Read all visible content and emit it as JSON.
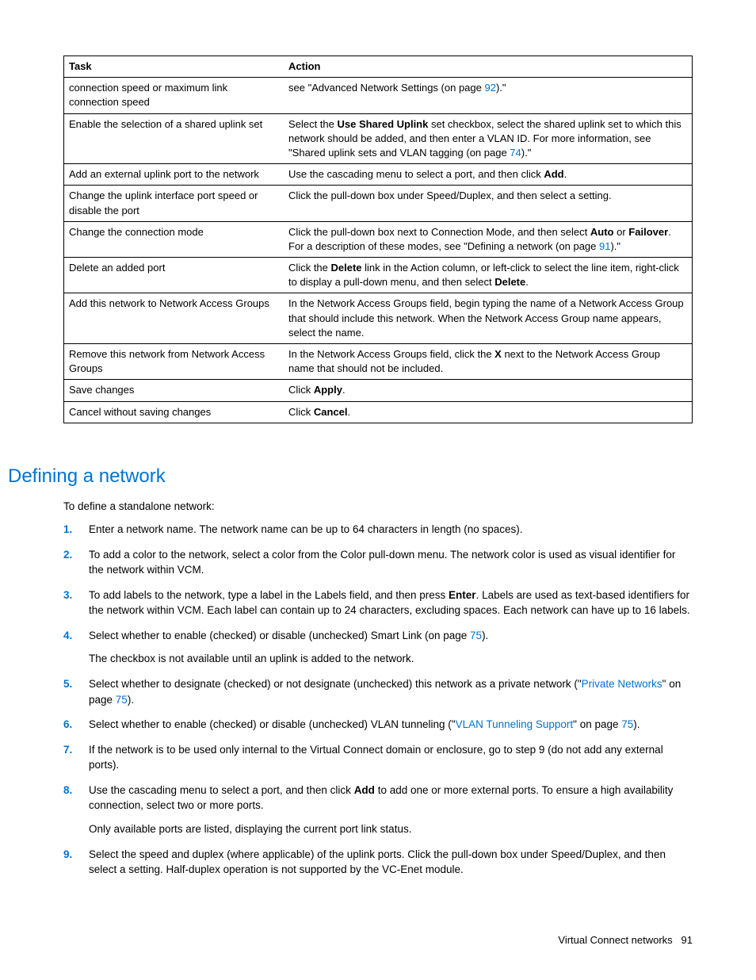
{
  "table": {
    "headers": [
      "Task",
      "Action"
    ],
    "rows": [
      {
        "task": "connection speed or maximum link connection speed",
        "action_pre": "see \"Advanced Network Settings (on page ",
        "action_link": "92",
        "action_post": ").\""
      },
      {
        "task": "Enable the selection of a shared uplink set",
        "action_segments": [
          {
            "t": "Select the "
          },
          {
            "t": "Use Shared Uplink",
            "b": true
          },
          {
            "t": " set checkbox, select the shared uplink set to which this network should be added, and then enter a VLAN ID. For more information, see \"Shared uplink sets and VLAN tagging (on page "
          },
          {
            "t": "74",
            "link": true
          },
          {
            "t": ").\""
          }
        ]
      },
      {
        "task": "Add an external uplink port to the network",
        "action_segments": [
          {
            "t": "Use the cascading menu to select a port, and then click "
          },
          {
            "t": "Add",
            "b": true
          },
          {
            "t": "."
          }
        ]
      },
      {
        "task": "Change the uplink interface port speed or disable the port",
        "action_segments": [
          {
            "t": "Click the pull-down box under Speed/Duplex, and then select a setting."
          }
        ]
      },
      {
        "task": "Change the connection mode",
        "action_segments": [
          {
            "t": "Click the pull-down box next to Connection Mode, and then select "
          },
          {
            "t": "Auto",
            "b": true
          },
          {
            "t": " or "
          },
          {
            "t": "Failover",
            "b": true
          },
          {
            "t": ". For a description of these modes, see \"Defining a network (on page "
          },
          {
            "t": "91",
            "link": true
          },
          {
            "t": ").\""
          }
        ]
      },
      {
        "task": "Delete an added port",
        "action_segments": [
          {
            "t": "Click the "
          },
          {
            "t": "Delete",
            "b": true
          },
          {
            "t": " link in the Action column, or left-click to select the line item, right-click to display a pull-down menu, and then select "
          },
          {
            "t": "Delete",
            "b": true
          },
          {
            "t": "."
          }
        ]
      },
      {
        "task": "Add this network to Network Access Groups",
        "action_segments": [
          {
            "t": "In the Network Access Groups field, begin typing the name of a Network Access Group that should include this network. When the Network Access Group name appears, select the name."
          }
        ]
      },
      {
        "task": "Remove this network from Network Access Groups",
        "action_segments": [
          {
            "t": "In the Network Access Groups field, click the "
          },
          {
            "t": "X",
            "b": true
          },
          {
            "t": " next to the Network Access Group name that should not be included."
          }
        ]
      },
      {
        "task": "Save changes",
        "action_segments": [
          {
            "t": "Click "
          },
          {
            "t": "Apply",
            "b": true
          },
          {
            "t": "."
          }
        ]
      },
      {
        "task": "Cancel without saving changes",
        "action_segments": [
          {
            "t": "Click "
          },
          {
            "t": "Cancel",
            "b": true
          },
          {
            "t": "."
          }
        ]
      }
    ]
  },
  "section": {
    "heading": "Defining a network",
    "intro": "To define a standalone network:",
    "items": [
      {
        "num": "1.",
        "paras": [
          [
            {
              "t": "Enter a network name. The network name can be up to 64 characters in length (no spaces)."
            }
          ]
        ]
      },
      {
        "num": "2.",
        "paras": [
          [
            {
              "t": "To add a color to the network, select a color from the Color pull-down menu. The network color is used as visual identifier for the network within VCM."
            }
          ]
        ]
      },
      {
        "num": "3.",
        "paras": [
          [
            {
              "t": "To add labels to the network, type a label in the Labels field, and then press "
            },
            {
              "t": "Enter",
              "b": true
            },
            {
              "t": ". Labels are used as text-based identifiers for the network within VCM. Each label can contain up to 24 characters, excluding spaces. Each network can have up to 16 labels."
            }
          ]
        ]
      },
      {
        "num": "4.",
        "paras": [
          [
            {
              "t": "Select whether to enable (checked) or disable (unchecked) Smart Link (on page "
            },
            {
              "t": "75",
              "link": true
            },
            {
              "t": ")."
            }
          ],
          [
            {
              "t": "The checkbox is not available until an uplink is added to the network."
            }
          ]
        ]
      },
      {
        "num": "5.",
        "paras": [
          [
            {
              "t": "Select whether to designate (checked) or not designate (unchecked) this network as a private network (\""
            },
            {
              "t": "Private Networks",
              "link": true
            },
            {
              "t": "\" on page "
            },
            {
              "t": "75",
              "link": true
            },
            {
              "t": ")."
            }
          ]
        ]
      },
      {
        "num": "6.",
        "paras": [
          [
            {
              "t": "Select whether to enable (checked) or disable (unchecked) VLAN tunneling (\""
            },
            {
              "t": "VLAN Tunneling Support",
              "link": true
            },
            {
              "t": "\" on page "
            },
            {
              "t": "75",
              "link": true
            },
            {
              "t": ")."
            }
          ]
        ]
      },
      {
        "num": "7.",
        "paras": [
          [
            {
              "t": "If the network is to be used only internal to the Virtual Connect domain or enclosure, go to step 9 (do not add any external ports)."
            }
          ]
        ]
      },
      {
        "num": "8.",
        "paras": [
          [
            {
              "t": "Use the cascading menu to select a port, and then click "
            },
            {
              "t": "Add",
              "b": true
            },
            {
              "t": " to add one or more external ports. To ensure a high availability connection, select two or more ports."
            }
          ],
          [
            {
              "t": "Only available ports are listed, displaying the current port link status."
            }
          ]
        ]
      },
      {
        "num": "9.",
        "paras": [
          [
            {
              "t": "Select the speed and duplex (where applicable) of the uplink ports. Click the pull-down box under Speed/Duplex, and then select a setting. Half-duplex operation is not supported by the VC-Enet module."
            }
          ]
        ]
      }
    ]
  },
  "footer": {
    "text": "Virtual Connect networks",
    "page": "91"
  }
}
